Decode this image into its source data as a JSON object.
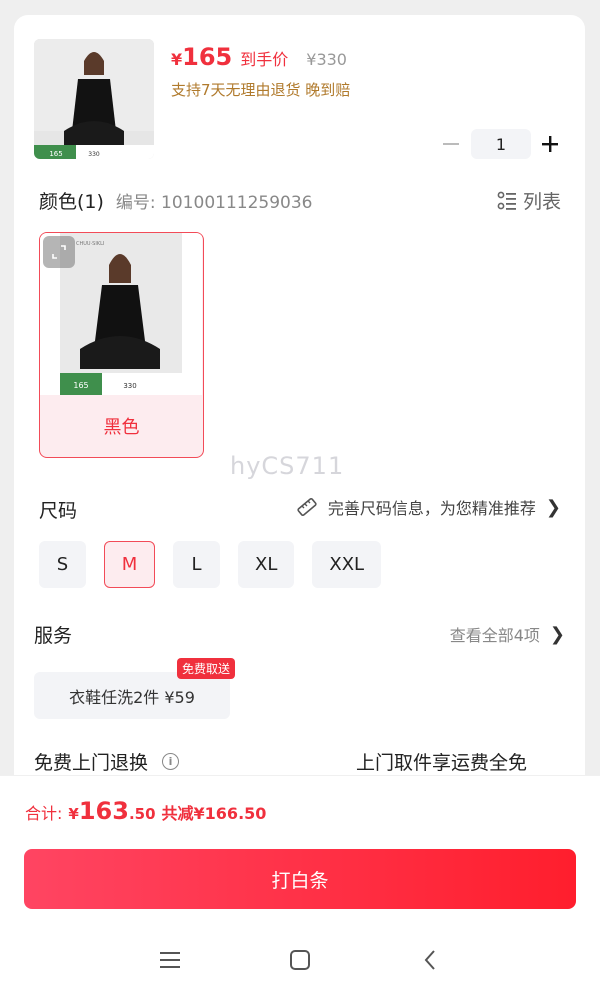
{
  "product": {
    "price_currency": "¥",
    "price_value": "165",
    "price_tag": "到手价",
    "original_price": "¥330",
    "promise": "支持7天无理由退货  晚到赔",
    "quantity": "1",
    "thumb_tag_price": "165",
    "thumb_tag_orig": "330"
  },
  "color_section": {
    "title": "颜色(1)",
    "code": "编号: 10100111259036",
    "list_label": "列表",
    "swatch_label": "黑色",
    "swatch_logo": "CHUU·SIKLI"
  },
  "watermark": "hyCS711",
  "size_section": {
    "title": "尺码",
    "tip": "完善尺码信息，为您精准推荐",
    "options": [
      "S",
      "M",
      "L",
      "XL",
      "XXL"
    ],
    "selected": "M"
  },
  "service_section": {
    "title": "服务",
    "more": "查看全部4项",
    "chip": "衣鞋任洗2件  ¥59",
    "badge": "免费取送"
  },
  "return_section": {
    "title": "免费上门退换",
    "desc": "上门取件享运费全免"
  },
  "total": {
    "label": "合计:",
    "currency": "¥",
    "integer": "163",
    "decimal": ".50",
    "saving": "共减¥166.50"
  },
  "action": {
    "pay_label": "打白条"
  },
  "colors": {
    "accent": "#f0303d",
    "promise": "#b07a2c",
    "chip_bg": "#f3f4f7"
  }
}
